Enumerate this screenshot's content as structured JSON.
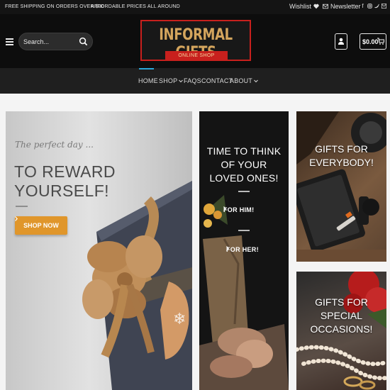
{
  "topbar": {
    "promo_shipping": "FREE SHIPPING ON ORDERS OVER $30",
    "promo_prices": "AFFORDABLE PRICES ALL AROUND",
    "wishlist": "Wishlist",
    "newsletter": "Newsletter",
    "socials": [
      "facebook-icon",
      "instagram-icon",
      "twitter-icon",
      "email-icon"
    ]
  },
  "header": {
    "search_placeholder": "Search...",
    "brand": "INFORMAL GIFTS",
    "brand_sub": "ONLINE SHOP",
    "cart_amount": "$0.00",
    "colors": {
      "brand_gold": "#d4a55d",
      "brand_red": "#c8201d",
      "accent_blue": "#2aa6d8",
      "cta_orange": "#e0962b"
    }
  },
  "nav": {
    "items": [
      {
        "label": "HOME",
        "active": true
      },
      {
        "label": "SHOP",
        "dropdown": true
      },
      {
        "label": "FAQS"
      },
      {
        "label": "CONTACT"
      },
      {
        "label": "ABOUT",
        "dropdown": true
      }
    ]
  },
  "hero": {
    "script": "The perfect day ...",
    "headline_line1": "TO REWARD",
    "headline_line2": "YOURSELF!",
    "cta": "SHOP NOW"
  },
  "middle": {
    "title_line1": "TIME TO THINK",
    "title_line2": "OF YOUR",
    "title_line3": "LOVED ONES!",
    "link_him": "FOR HIM!",
    "link_her": "FOR HER!"
  },
  "topright": {
    "title_line1": "GIFTS FOR",
    "title_line2": "EVERYBODY!"
  },
  "botright": {
    "title_line1": "GIFTS FOR",
    "title_line2": "SPECIAL",
    "title_line3": "OCCASIONS!"
  }
}
